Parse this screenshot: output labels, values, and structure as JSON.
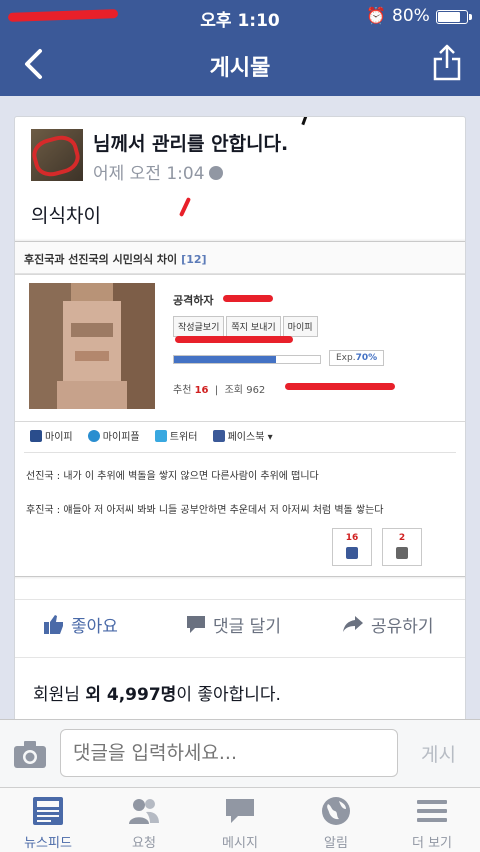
{
  "status": {
    "time": "오후 1:10",
    "battery": "80%",
    "battery_level": 0.8
  },
  "nav": {
    "title": "게시물"
  },
  "post": {
    "author": "님께서 관리를 안합니다.",
    "timestamp": "어제 오전 1:04",
    "text": "의식차이",
    "embed": {
      "title": "후진국과 선진국의 시민의식 차이",
      "count": "[12]",
      "nickname": "공격하자",
      "buttons": [
        "작성글보기",
        "쪽지 보내기",
        "마이피"
      ],
      "exp_label": "Exp.",
      "exp_value": "70%",
      "exp_level": 0.7,
      "rec_label": "추천",
      "rec_value": "16",
      "views_label": "조회",
      "views_value": "962",
      "sns": [
        "마이피",
        "마이피플",
        "트위터",
        "페이스북"
      ],
      "line1": "선진국 : 내가 이 추위에 벽돌을 쌓지 않으면 다른사람이 추위에 떱니다",
      "line2": "후진국 : 얘들아 저 아저씨 봐봐 니들 공부안하면 추운데서 저 아저씨 처럼 벽돌 쌓는다",
      "vote_up": "16",
      "vote_down": "2"
    },
    "actions": {
      "like": "좋아요",
      "comment": "댓글 달기",
      "share": "공유하기"
    },
    "likes_prefix": "회원님 ",
    "likes_bold": "외 4,997명",
    "likes_suffix": "이 좋아합니다."
  },
  "comment": {
    "placeholder": "댓글을 입력하세요...",
    "post_label": "게시"
  },
  "tabs": [
    {
      "label": "뉴스피드",
      "icon": "news-feed-icon"
    },
    {
      "label": "요청",
      "icon": "friend-requests-icon"
    },
    {
      "label": "메시지",
      "icon": "messages-icon"
    },
    {
      "label": "알림",
      "icon": "notifications-globe-icon"
    },
    {
      "label": "더 보기",
      "icon": "more-menu-icon"
    }
  ],
  "colors": {
    "brand": "#3b5998",
    "accent": "#4a6aa8",
    "redaction": "#e8202a"
  }
}
